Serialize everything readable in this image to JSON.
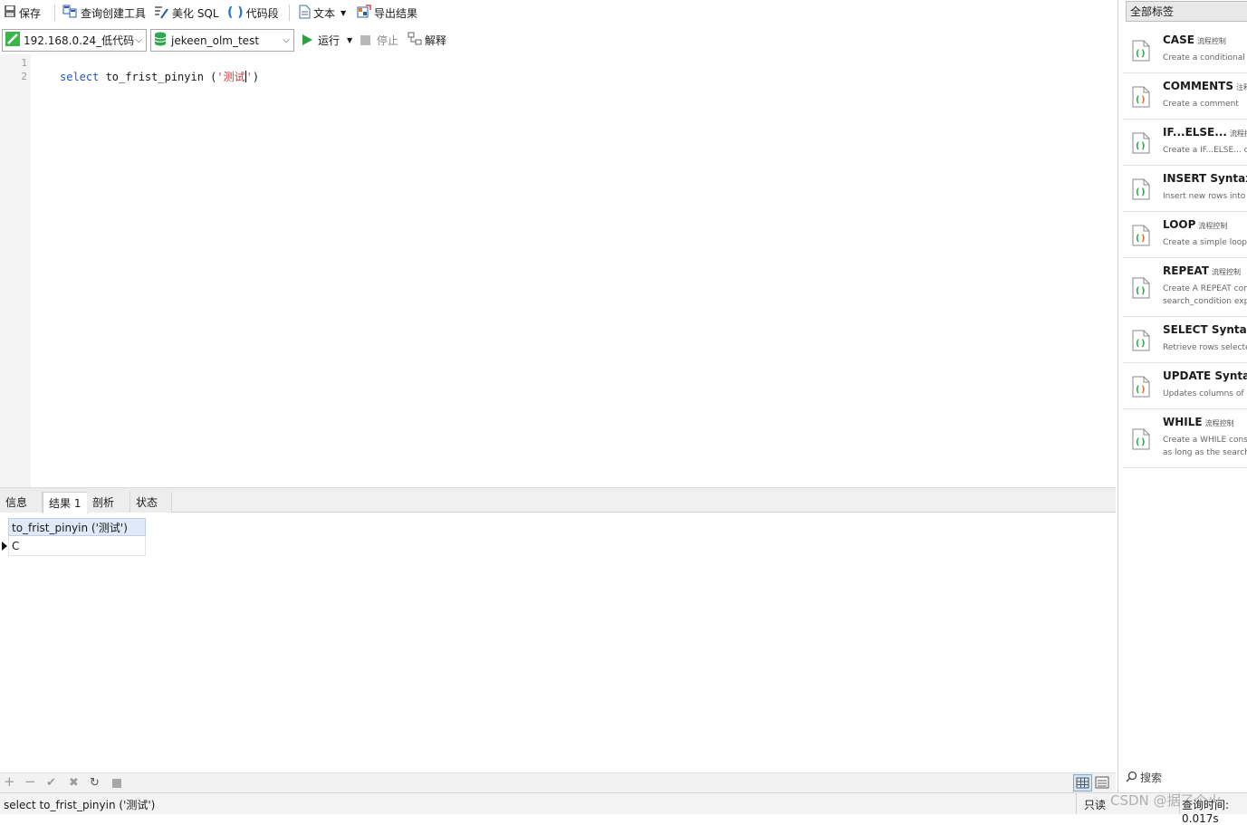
{
  "toolbar": {
    "save": "保存",
    "query_builder": "查询创建工具",
    "beautify": "美化 SQL",
    "snippet": "代码段",
    "text": "文本",
    "export": "导出结果"
  },
  "toolbar2": {
    "connection": "192.168.0.24_低代码",
    "database": "jekeen_olm_test",
    "run": "运行",
    "stop": "停止",
    "explain": "解释"
  },
  "editor": {
    "line_numbers": [
      "1",
      "2"
    ],
    "code_keyword": "select",
    "code_func": " to_frist_pinyin (",
    "code_q1": "'",
    "code_str": "测试",
    "code_q2": "'",
    "code_end": ")"
  },
  "tabs": [
    "信息",
    "结果 1",
    "剖析",
    "状态"
  ],
  "result": {
    "column": "to_frist_pinyin ('测试')",
    "value": "C"
  },
  "status": {
    "sql": "select to_frist_pinyin ('测试')",
    "readonly": "只读",
    "query_time": "查询时间: 0.017s",
    "watermark": "CSDN @据了个火"
  },
  "panel": {
    "header": "全部标签",
    "search": "搜索",
    "snippets": [
      {
        "title": "CASE",
        "tag": "流程控制",
        "desc": [
          "Create a conditional c"
        ]
      },
      {
        "title": "COMMENTS",
        "tag": "注释",
        "desc": [
          "Create a comment"
        ]
      },
      {
        "title": "IF...ELSE...",
        "tag": "流程控制",
        "desc": [
          "Create a IF...ELSE... co"
        ]
      },
      {
        "title": "INSERT Syntax",
        "tag": "",
        "desc": [
          "Insert new rows into a"
        ]
      },
      {
        "title": "LOOP",
        "tag": "流程控制",
        "desc": [
          "Create a simple loop c"
        ]
      },
      {
        "title": "REPEAT",
        "tag": "流程控制",
        "desc": [
          "Create A REPEAT cons",
          "search_condition exp"
        ]
      },
      {
        "title": "SELECT Syntax",
        "tag": "",
        "desc": [
          "Retrieve rows selected"
        ]
      },
      {
        "title": "UPDATE Syntax",
        "tag": "",
        "desc": [
          "Updates columns of e"
        ]
      },
      {
        "title": "WHILE",
        "tag": "流程控制",
        "desc": [
          "Create a WHILE const",
          "as long as the search_"
        ]
      }
    ]
  },
  "colors": {
    "keyword": "#2156c7",
    "string": "#d2353a",
    "run_green": "#2ea043",
    "grid_header": "#dfe9f7"
  }
}
